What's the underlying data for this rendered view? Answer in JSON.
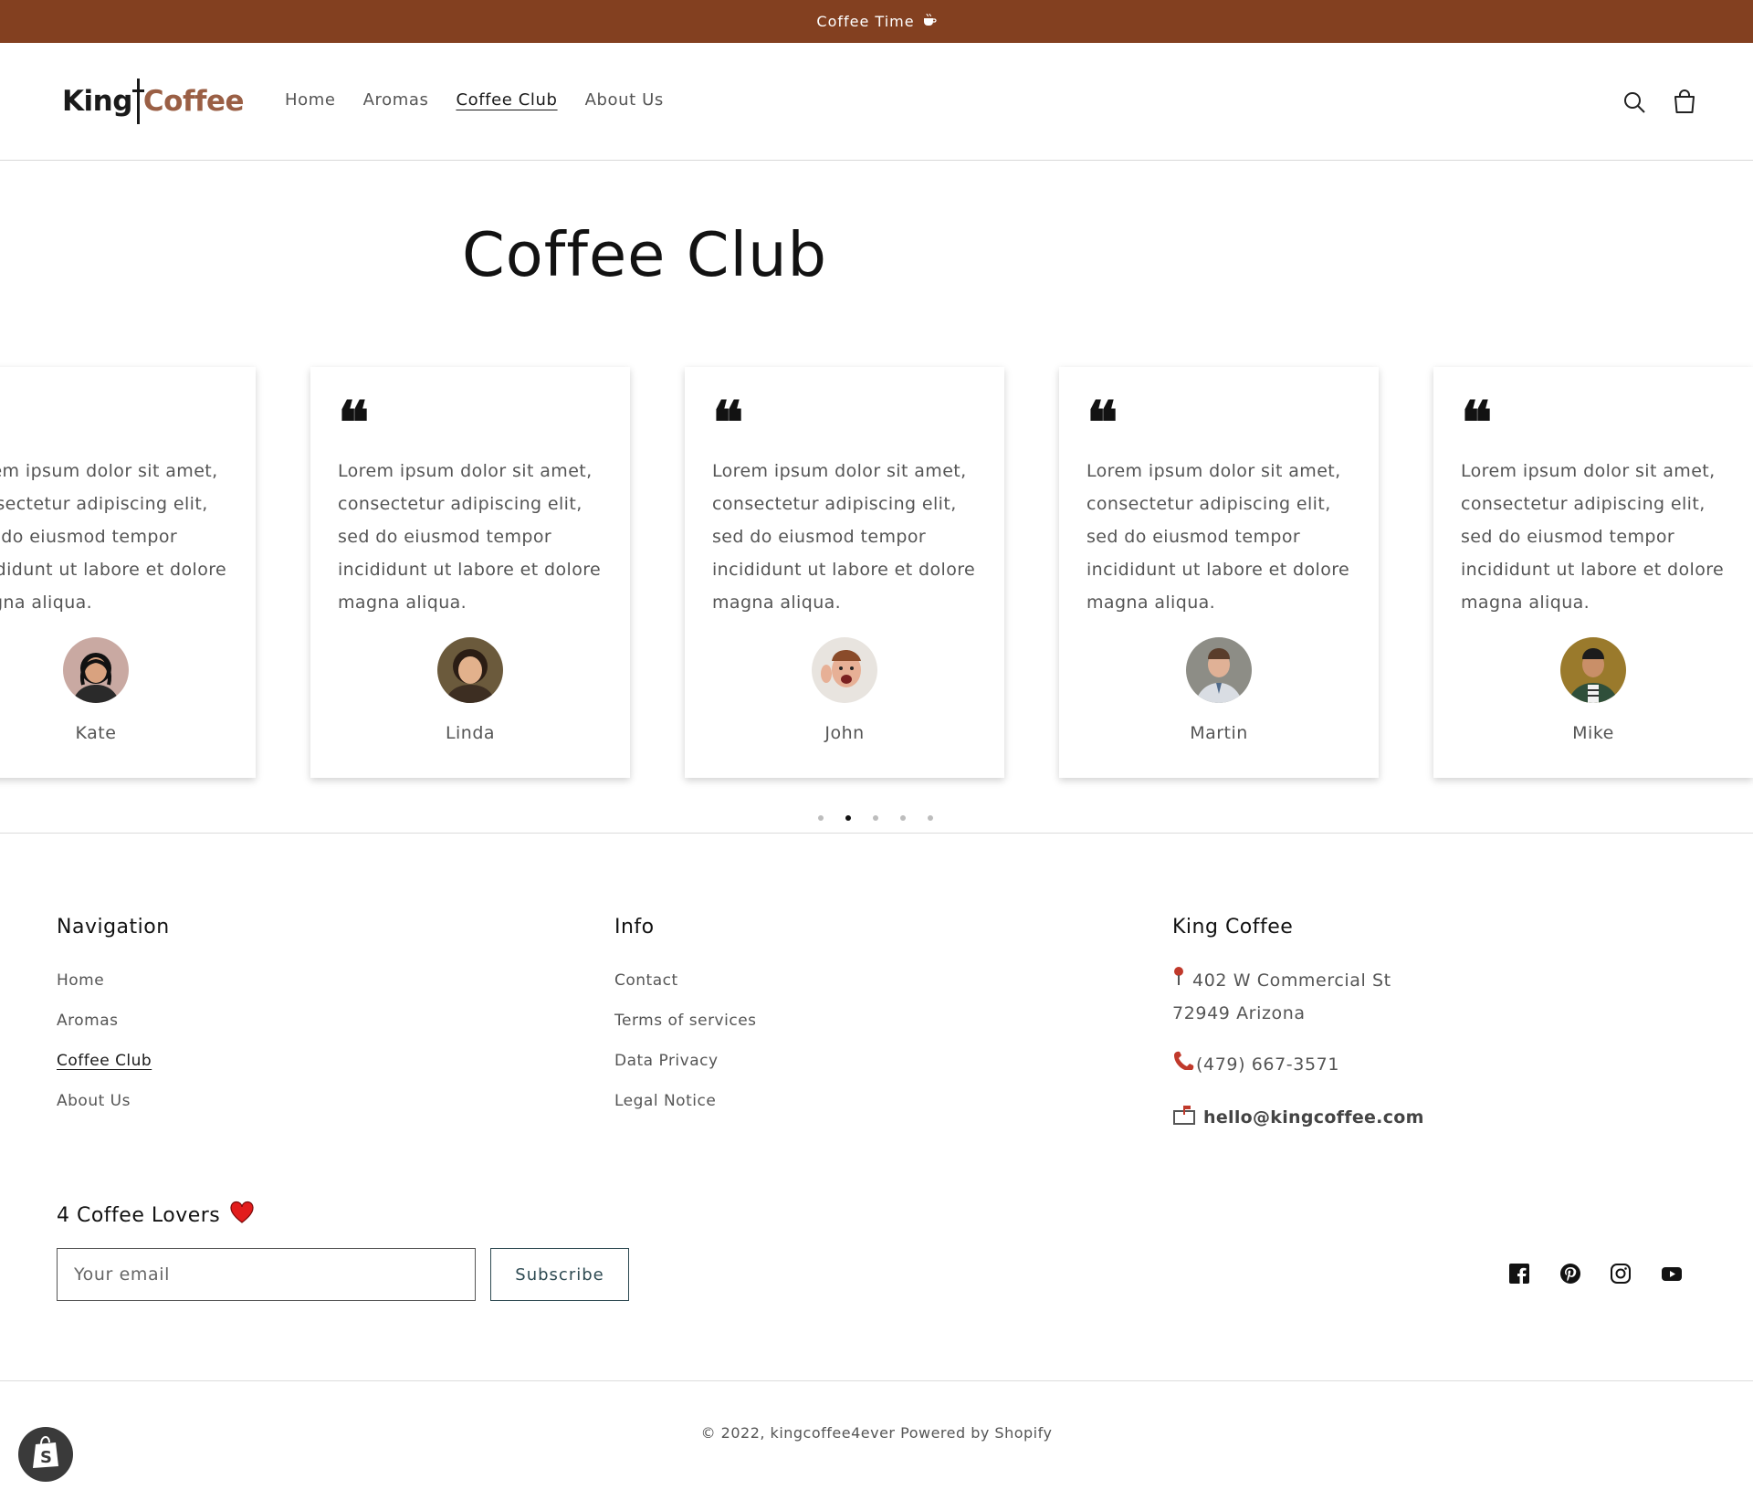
{
  "announcement": {
    "text": "Coffee Time",
    "icon": "coffee-cup-icon"
  },
  "header": {
    "logo": {
      "part1": "King",
      "part2": "Coffee"
    },
    "nav": [
      {
        "label": "Home"
      },
      {
        "label": "Aromas"
      },
      {
        "label": "Coffee Club",
        "active": true
      },
      {
        "label": "About Us"
      }
    ],
    "icons": [
      "search-icon",
      "cart-icon"
    ]
  },
  "main": {
    "title": "Coffee Club",
    "testimonials": [
      {
        "text": "Lorem ipsum dolor sit amet, consectetur adipiscing elit, sed do eiusmod tempor incididunt ut labore et dolore magna aliqua.",
        "name": "Kate"
      },
      {
        "text": "Lorem ipsum dolor sit amet, consectetur adipiscing elit, sed do eiusmod tempor incididunt ut labore et dolore magna aliqua.",
        "name": "Linda"
      },
      {
        "text": "Lorem ipsum dolor sit amet, consectetur adipiscing elit, sed do eiusmod tempor incididunt ut labore et dolore magna aliqua.",
        "name": "John"
      },
      {
        "text": "Lorem ipsum dolor sit amet, consectetur adipiscing elit, sed do eiusmod tempor incididunt ut labore et dolore magna aliqua.",
        "name": "Martin"
      },
      {
        "text": "Lorem ipsum dolor sit amet, consectetur adipiscing elit, sed do eiusmod tempor incididunt ut labore et dolore magna aliqua.",
        "name": "Mike"
      }
    ],
    "slider": {
      "total": 5,
      "active": 2
    }
  },
  "footer": {
    "navigation": {
      "heading": "Navigation",
      "links": [
        "Home",
        "Aromas",
        "Coffee Club",
        "About Us"
      ]
    },
    "info": {
      "heading": "Info",
      "links": [
        "Contact",
        "Terms of services",
        "Data Privacy",
        "Legal Notice"
      ]
    },
    "company": {
      "heading": "King Coffee",
      "address_line1": "402 W Commercial St",
      "address_line2": "72949 Arizona",
      "phone": "(479) 667-3571",
      "email": "hello@kingcoffee.com"
    },
    "newsletter": {
      "title": "4 Coffee Lovers",
      "placeholder": "Your email",
      "button": "Subscribe"
    },
    "social": [
      "facebook-icon",
      "pinterest-icon",
      "instagram-icon",
      "youtube-icon"
    ],
    "copyright_year": "© 2022,",
    "copyright_shop": "kingcoffee4ever",
    "copyright_powered": "Powered by Shopify"
  },
  "colors": {
    "announcement_bg": "#834020",
    "logo_accent": "#9a5f45",
    "button_border": "#2e4a52"
  }
}
